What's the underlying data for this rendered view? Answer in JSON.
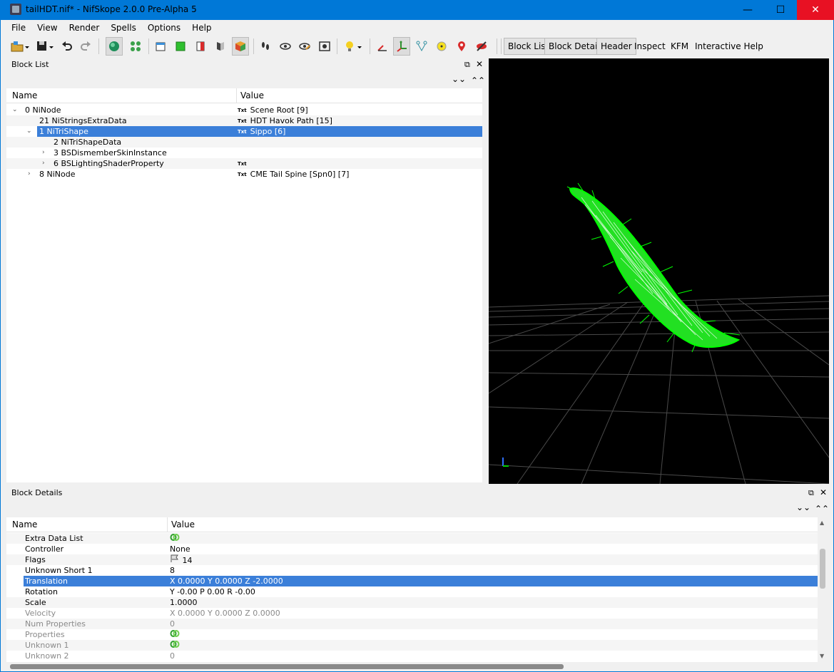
{
  "window": {
    "title": "tailHDT.nif* - NifSkope 2.0.0 Pre-Alpha 5",
    "minimize": "—",
    "maximize": "☐",
    "close": "✕"
  },
  "menu": [
    "File",
    "View",
    "Render",
    "Spells",
    "Options",
    "Help"
  ],
  "toolbar": {
    "text_buttons": [
      "Block List",
      "Block Details",
      "Header",
      "Inspect",
      "KFM",
      "Interactive Help"
    ]
  },
  "block_list": {
    "title": "Block List",
    "columns": {
      "name": "Name",
      "value": "Value"
    },
    "rows": [
      {
        "name": "0 NiNode",
        "value": "Scene Root [9]",
        "badge": "Txt",
        "expanded": true
      },
      {
        "name": "21 NiStringsExtraData",
        "value": "HDT Havok Path [15]",
        "badge": "Txt"
      },
      {
        "name": "1 NiTriShape",
        "value": "Sippo [6]",
        "badge": "Txt",
        "selected": true,
        "expanded": true
      },
      {
        "name": "2 NiTriShapeData",
        "value": "",
        "badge": ""
      },
      {
        "name": "3 BSDismemberSkinInstance",
        "value": "",
        "badge": "",
        "collapsed": true
      },
      {
        "name": "6 BSLightingShaderProperty",
        "value": "",
        "badge": "Txt",
        "collapsed": true
      },
      {
        "name": "8 NiNode",
        "value": "CME Tail Spine [Spn0] [7]",
        "badge": "Txt",
        "collapsed": true
      }
    ]
  },
  "block_details": {
    "title": "Block Details",
    "columns": {
      "name": "Name",
      "value": "Value"
    },
    "rows": [
      {
        "name": "Extra Data List",
        "value": "",
        "icon": "link-icon"
      },
      {
        "name": "Controller",
        "value": "None"
      },
      {
        "name": "Flags",
        "value": "14",
        "icon": "flag-icon"
      },
      {
        "name": "Unknown Short 1",
        "value": "8"
      },
      {
        "name": "Translation",
        "value": "X 0.0000 Y 0.0000 Z -2.0000",
        "selected": true
      },
      {
        "name": "Rotation",
        "value": "Y -0.00 P 0.00 R -0.00"
      },
      {
        "name": "Scale",
        "value": "1.0000"
      },
      {
        "name": "Velocity",
        "value": "X 0.0000 Y 0.0000 Z 0.0000",
        "disabled": true
      },
      {
        "name": "Num Properties",
        "value": "0",
        "disabled": true
      },
      {
        "name": "Properties",
        "value": "",
        "icon": "link-icon",
        "disabled": true
      },
      {
        "name": "Unknown 1",
        "value": "",
        "icon": "link-icon",
        "disabled": true
      },
      {
        "name": "Unknown 2",
        "value": "0",
        "disabled": true
      }
    ]
  },
  "colors": {
    "titlebar": "#0078d7",
    "selection": "#3b7fd9",
    "viewport_bg": "#000000",
    "mesh": "#00ff00",
    "grid": "#555555"
  }
}
